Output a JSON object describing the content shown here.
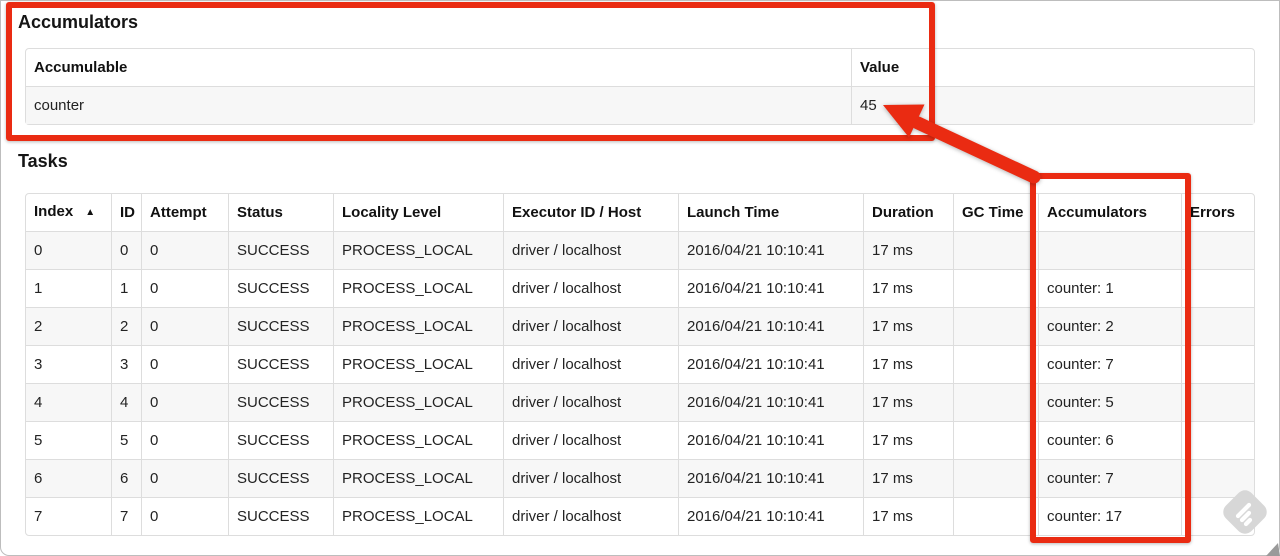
{
  "page": {
    "accumulators_heading": "Accumulators",
    "tasks_heading": "Tasks"
  },
  "accumulators_table": {
    "columns": [
      "Accumulable",
      "Value"
    ],
    "rows": [
      {
        "accumulable": "counter",
        "value": "45"
      }
    ]
  },
  "tasks_table": {
    "columns": [
      {
        "label": "Index",
        "sort": "asc"
      },
      {
        "label": "ID"
      },
      {
        "label": "Attempt"
      },
      {
        "label": "Status"
      },
      {
        "label": "Locality Level"
      },
      {
        "label": "Executor ID / Host"
      },
      {
        "label": "Launch Time"
      },
      {
        "label": "Duration"
      },
      {
        "label": "GC Time"
      },
      {
        "label": "Accumulators"
      },
      {
        "label": "Errors"
      }
    ],
    "rows": [
      [
        "0",
        "0",
        "0",
        "SUCCESS",
        "PROCESS_LOCAL",
        "driver / localhost",
        "2016/04/21 10:10:41",
        "17 ms",
        "",
        "",
        ""
      ],
      [
        "1",
        "1",
        "0",
        "SUCCESS",
        "PROCESS_LOCAL",
        "driver / localhost",
        "2016/04/21 10:10:41",
        "17 ms",
        "",
        "counter: 1",
        ""
      ],
      [
        "2",
        "2",
        "0",
        "SUCCESS",
        "PROCESS_LOCAL",
        "driver / localhost",
        "2016/04/21 10:10:41",
        "17 ms",
        "",
        "counter: 2",
        ""
      ],
      [
        "3",
        "3",
        "0",
        "SUCCESS",
        "PROCESS_LOCAL",
        "driver / localhost",
        "2016/04/21 10:10:41",
        "17 ms",
        "",
        "counter: 7",
        ""
      ],
      [
        "4",
        "4",
        "0",
        "SUCCESS",
        "PROCESS_LOCAL",
        "driver / localhost",
        "2016/04/21 10:10:41",
        "17 ms",
        "",
        "counter: 5",
        ""
      ],
      [
        "5",
        "5",
        "0",
        "SUCCESS",
        "PROCESS_LOCAL",
        "driver / localhost",
        "2016/04/21 10:10:41",
        "17 ms",
        "",
        "counter: 6",
        ""
      ],
      [
        "6",
        "6",
        "0",
        "SUCCESS",
        "PROCESS_LOCAL",
        "driver / localhost",
        "2016/04/21 10:10:41",
        "17 ms",
        "",
        "counter: 7",
        ""
      ],
      [
        "7",
        "7",
        "0",
        "SUCCESS",
        "PROCESS_LOCAL",
        "driver / localhost",
        "2016/04/21 10:10:41",
        "17 ms",
        "",
        "counter: 17",
        ""
      ]
    ]
  },
  "icons": {
    "sort_ascending": "▲",
    "watermark": "skitch-watermark"
  },
  "annotations": {
    "accent_red": "#ea2b12",
    "highlighted_value": "45",
    "highlighted_column": "Accumulators"
  }
}
